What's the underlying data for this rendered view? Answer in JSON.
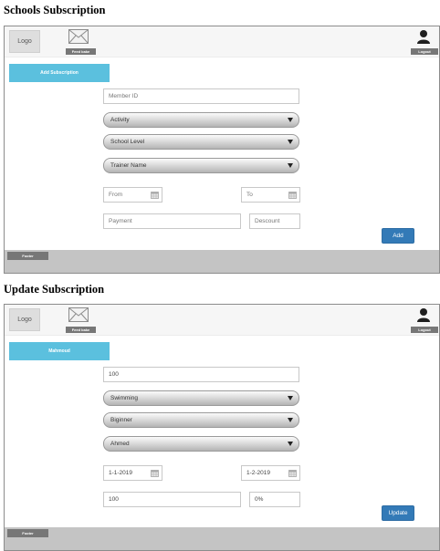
{
  "screens": [
    {
      "title": "Schools Subscription",
      "header": {
        "logo": "Logo",
        "feedback_label": "Feed bake",
        "logout_label": "Logout"
      },
      "tab_label": "Add Subscription",
      "member_field": {
        "placeholder": "Member ID",
        "value": ""
      },
      "activity_select": "Activity",
      "level_select": "School Level",
      "trainer_select": "Trainer Name",
      "from_field": {
        "placeholder": "From",
        "value": ""
      },
      "to_field": {
        "placeholder": "To",
        "value": ""
      },
      "payment_field": {
        "placeholder": "Payment",
        "value": ""
      },
      "discount_field": {
        "placeholder": "Descount",
        "value": ""
      },
      "action_button": "Add",
      "footer_label": "Footer"
    },
    {
      "title": "Update Subscription",
      "header": {
        "logo": "Logo",
        "feedback_label": "Feed bake",
        "logout_label": "Logout"
      },
      "tab_label": "Mahmoud",
      "member_field": {
        "placeholder": "",
        "value": "100"
      },
      "activity_select": "Swimming",
      "level_select": "Biginner",
      "trainer_select": "Ahmed",
      "from_field": {
        "placeholder": "",
        "value": "1-1-2019"
      },
      "to_field": {
        "placeholder": "",
        "value": "1-2-2019"
      },
      "payment_field": {
        "placeholder": "",
        "value": "100"
      },
      "discount_field": {
        "placeholder": "",
        "value": "0%"
      },
      "action_button": "Update",
      "footer_label": "Footer"
    }
  ],
  "icons": {
    "message": "envelope-icon",
    "user": "user-icon",
    "calendar": "calendar-icon",
    "dropdown": "chevron-down-icon"
  },
  "colors": {
    "tab": "#5bc0de",
    "button": "#337ab7",
    "footer": "#c4c4c4",
    "label_bg": "#777777"
  }
}
